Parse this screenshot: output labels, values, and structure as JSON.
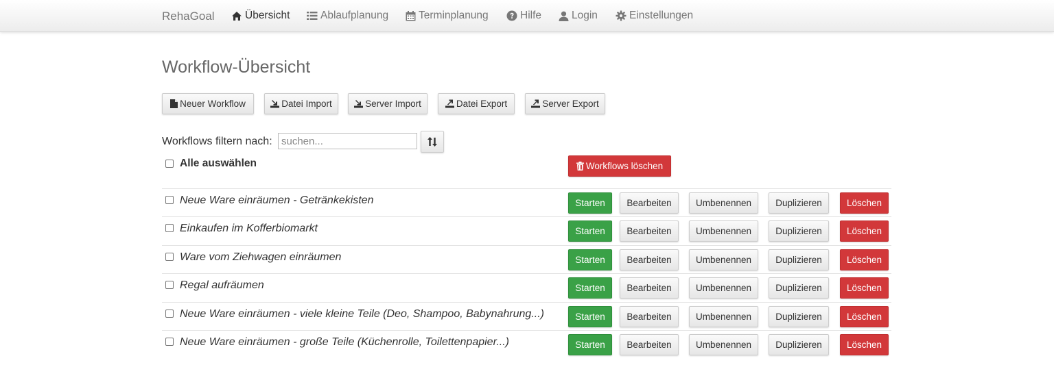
{
  "nav": {
    "brand": "RehaGoal",
    "items": [
      {
        "label": "Übersicht",
        "icon": "home-icon",
        "active": true
      },
      {
        "label": "Ablaufplanung",
        "icon": "list-icon"
      },
      {
        "label": "Terminplanung",
        "icon": "calendar-icon"
      },
      {
        "label": "Hilfe",
        "icon": "question-circle-icon"
      },
      {
        "label": "Login",
        "icon": "user-icon"
      },
      {
        "label": "Einstellungen",
        "icon": "gear-icon"
      }
    ]
  },
  "page": {
    "title": "Workflow-Übersicht"
  },
  "toolbar": {
    "new_workflow": "Neuer Workflow",
    "file_import": "Datei Import",
    "server_import": "Server Import",
    "file_export": "Datei Export",
    "server_export": "Server Export"
  },
  "filter": {
    "label": "Workflows filtern nach:",
    "placeholder": "suchen...",
    "value": ""
  },
  "select_all": {
    "label": "Alle auswählen",
    "checked": false
  },
  "delete_workflows": "Workflows löschen",
  "row_actions": {
    "start": "Starten",
    "edit": "Bearbeiten",
    "rename": "Umbenennen",
    "duplicate": "Duplizieren",
    "delete": "Löschen"
  },
  "workflows": [
    {
      "name": "Neue Ware einräumen - Getränkekisten",
      "checked": false
    },
    {
      "name": "Einkaufen im Kofferbiomarkt",
      "checked": false
    },
    {
      "name": "Ware vom Ziehwagen einräumen",
      "checked": false
    },
    {
      "name": "Regal aufräumen",
      "checked": false
    },
    {
      "name": "Neue Ware einräumen - viele kleine Teile (Deo, Shampoo, Babynahrung...)",
      "checked": false
    },
    {
      "name": "Neue Ware einräumen - große Teile (Küchenrolle, Toilettenpapier...)",
      "checked": false
    }
  ],
  "colors": {
    "start": "#3aa147",
    "delete": "#d2383a",
    "nav_text": "#777777"
  }
}
